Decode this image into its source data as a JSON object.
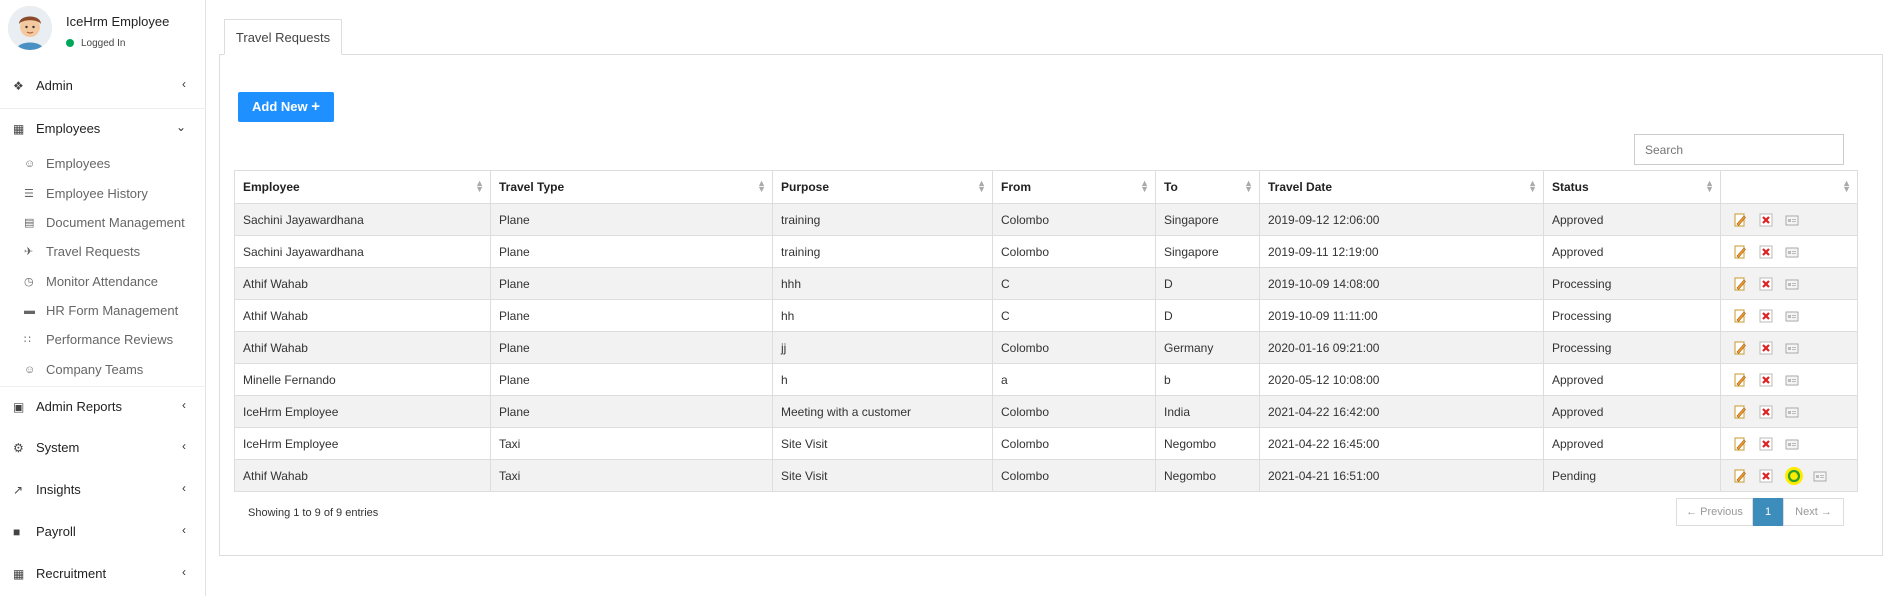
{
  "user": {
    "name": "IceHrm Employee",
    "status": "Logged In"
  },
  "menu": {
    "admin": "Admin",
    "employees": "Employees",
    "sub_items": [
      {
        "label": "Employees",
        "icon": "users-icon"
      },
      {
        "label": "Employee History",
        "icon": "list-icon"
      },
      {
        "label": "Document Management",
        "icon": "file-icon"
      },
      {
        "label": "Travel Requests",
        "icon": "plane-icon"
      },
      {
        "label": "Monitor Attendance",
        "icon": "clock-icon"
      },
      {
        "label": "HR Form Management",
        "icon": "folder-icon"
      },
      {
        "label": "Performance Reviews",
        "icon": "network-icon"
      },
      {
        "label": "Company Teams",
        "icon": "users-icon"
      }
    ],
    "admin_reports": "Admin Reports",
    "system": "System",
    "insights": "Insights",
    "payroll": "Payroll",
    "recruitment": "Recruitment"
  },
  "tab": {
    "label": "Travel Requests"
  },
  "toolbar": {
    "add_label": "Add New"
  },
  "search": {
    "placeholder": "Search"
  },
  "table": {
    "columns": [
      "Employee",
      "Travel Type",
      "Purpose",
      "From",
      "To",
      "Travel Date",
      "Status"
    ],
    "rows": [
      [
        "Sachini Jayawardhana",
        "Plane",
        "training",
        "Colombo",
        "Singapore",
        "2019-09-12 12:06:00",
        "Approved"
      ],
      [
        "Sachini Jayawardhana",
        "Plane",
        "training",
        "Colombo",
        "Singapore",
        "2019-09-11 12:19:00",
        "Approved"
      ],
      [
        "Athif Wahab",
        "Plane",
        "hhh",
        "C",
        "D",
        "2019-10-09 14:08:00",
        "Processing"
      ],
      [
        "Athif Wahab",
        "Plane",
        "hh",
        "C",
        "D",
        "2019-10-09 11:11:00",
        "Processing"
      ],
      [
        "Athif Wahab",
        "Plane",
        "jj",
        "Colombo",
        "Germany",
        "2020-01-16 09:21:00",
        "Processing"
      ],
      [
        "Minelle Fernando",
        "Plane",
        "h",
        "a",
        "b",
        "2020-05-12 10:08:00",
        "Approved"
      ],
      [
        "IceHrm Employee",
        "Plane",
        "Meeting with a customer",
        "Colombo",
        "India",
        "2021-04-22 16:42:00",
        "Approved"
      ],
      [
        "IceHrm Employee",
        "Taxi",
        "Site Visit",
        "Colombo",
        "Negombo",
        "2021-04-22 16:45:00",
        "Approved"
      ],
      [
        "Athif Wahab",
        "Taxi",
        "Site Visit",
        "Colombo",
        "Negombo",
        "2021-04-21 16:51:00",
        "Pending"
      ]
    ]
  },
  "footer": {
    "info": "Showing 1 to 9 of 9 entries",
    "previous": "← Previous",
    "page": "1",
    "next": "Next →"
  },
  "colors": {
    "accent": "#1e90ff",
    "active_page": "#3c8dbc",
    "status_online": "#00a65a",
    "highlight": "#ffeb00"
  }
}
